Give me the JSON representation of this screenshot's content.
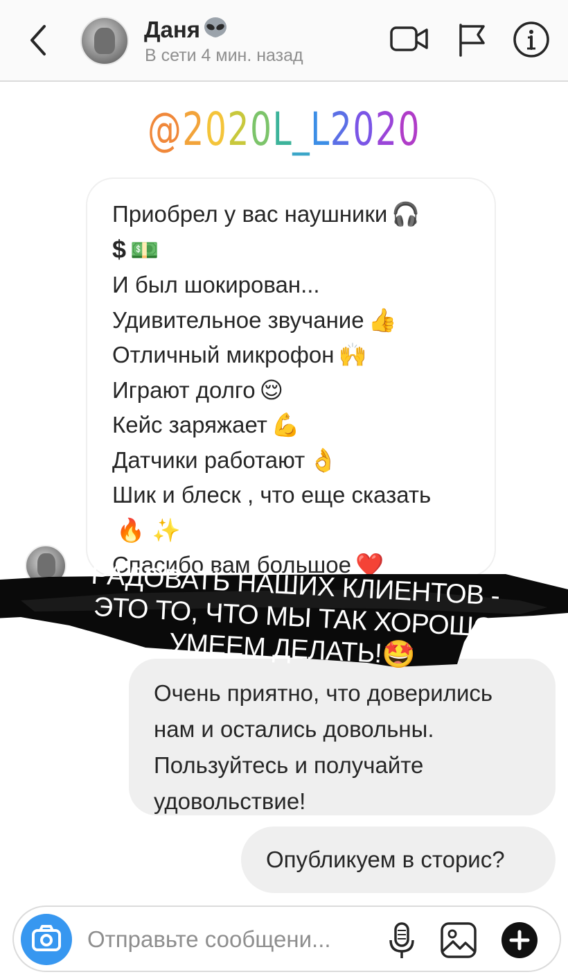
{
  "header": {
    "back_icon": "chevron-left-icon",
    "contact_name": "Даня",
    "name_emoji": "👽",
    "status": "В сети 4 мин. назад",
    "icons": [
      "video-call-icon",
      "flag-icon",
      "info-icon"
    ]
  },
  "story": {
    "handle": "@2020L_L2020",
    "handle_colors": [
      "#f0883a",
      "#f2a33a",
      "#f4c43a",
      "#c8c83c",
      "#7cc46a",
      "#3cb39a",
      "#3ca6c8",
      "#3c8ee6",
      "#5b6fe6",
      "#7a55e6",
      "#9a45d8",
      "#b03cc8"
    ],
    "banner_lines": [
      "РАДОВАТЬ НАШИХ КЛИЕНТОВ -",
      "ЭТО ТО, ЧТО МЫ ТАК ХОРОШО",
      "УМЕЕМ ДЕЛАТЬ!🤩"
    ]
  },
  "messages": {
    "received": {
      "lines": [
        {
          "text": "Приобрел у вас наушники",
          "emoji": "🎧"
        },
        {
          "text": "$",
          "emoji": "💵"
        },
        {
          "text": "И был шокирован...",
          "emoji": ""
        },
        {
          "text": "Удивительное звучание",
          "emoji": "👍"
        },
        {
          "text": "Отличный микрофон",
          "emoji": "🙌"
        },
        {
          "text": "Играют долго",
          "emoji": "😌"
        },
        {
          "text": "Кейс заряжает",
          "emoji": "💪"
        },
        {
          "text": "Датчики работают",
          "emoji": "👌"
        },
        {
          "text": "Шик и блеск , что еще сказать",
          "emoji": ""
        },
        {
          "text": "",
          "emoji": "🔥 ✨"
        },
        {
          "text": "Спасибо вам большое",
          "emoji": "❤️"
        }
      ]
    },
    "sent_reply_lines": [
      "Очень приятно, что доверились",
      "нам и остались довольны.",
      "Пользуйтесь и получайте",
      "удовольствие!"
    ],
    "sent_question": "Опубликуем в сторис?"
  },
  "composer": {
    "placeholder": "Отправьте сообщени...",
    "icons": [
      "camera-icon",
      "microphone-icon",
      "gallery-icon",
      "plus-icon"
    ],
    "accent_color": "#3797f0"
  }
}
